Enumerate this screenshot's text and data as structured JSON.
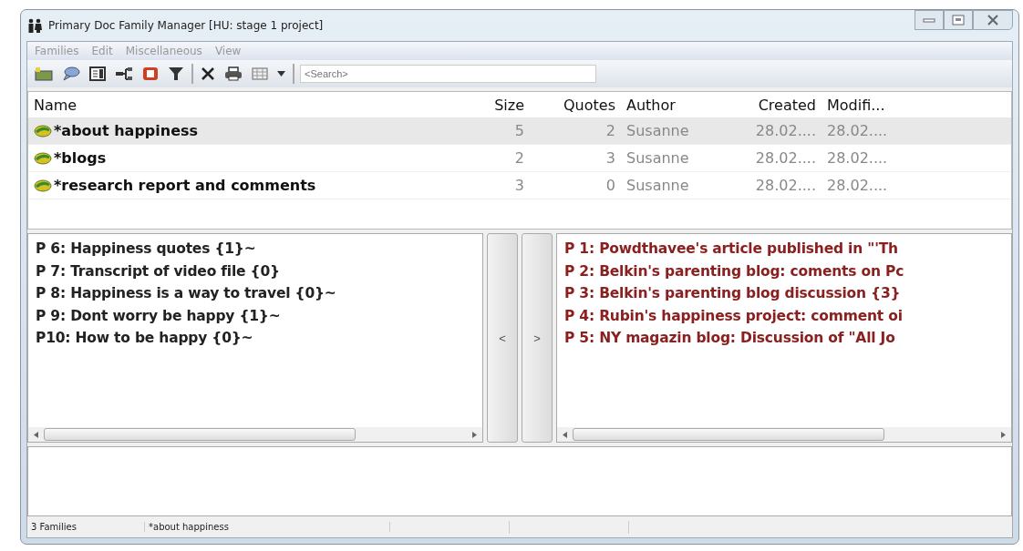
{
  "window": {
    "title": "Primary Doc Family Manager [HU: stage 1 project]"
  },
  "menu": [
    "Families",
    "Edit",
    "Miscellaneous",
    "View"
  ],
  "search": {
    "placeholder": "<Search>"
  },
  "table": {
    "columns": [
      {
        "label": "Name",
        "kind": "text"
      },
      {
        "label": "Size",
        "kind": "number"
      },
      {
        "label": "Quotes",
        "kind": "number"
      },
      {
        "label": "Author",
        "kind": "text"
      },
      {
        "label": "Created",
        "kind": "number"
      },
      {
        "label": "Modifi...",
        "kind": "text"
      }
    ],
    "rows": [
      {
        "selected": true,
        "cells": [
          "*about happiness",
          "5",
          "2",
          "Susanne",
          "28.02....",
          "28.02...."
        ]
      },
      {
        "selected": false,
        "cells": [
          "*blogs",
          "2",
          "3",
          "Susanne",
          "28.02....",
          "28.02...."
        ]
      },
      {
        "selected": false,
        "cells": [
          "*research report and comments",
          "3",
          "0",
          "Susanne",
          "28.02....",
          "28.02...."
        ]
      }
    ]
  },
  "non_members": [
    "P 6: Happiness quotes {1}~",
    "P 7: Transcript of video file {0}",
    "P 8: Happiness is a way to travel {0}~",
    "P 9: Dont worry be happy {1}~",
    "P10: How to be happy {0}~"
  ],
  "move_buttons": [
    "<",
    ">"
  ],
  "members": [
    "P 1: Powdthavee's article published in \"'Th",
    "P 2: Belkin's parenting blog: coments on Pc",
    "P 3: Belkin's parenting blog discussion {3}",
    "P 4: Rubin's happiness project: comment oi",
    "P 5: NY magazin blog: Discussion of \"All Jo"
  ],
  "status_bar": [
    "3 Families",
    "*about happiness"
  ]
}
